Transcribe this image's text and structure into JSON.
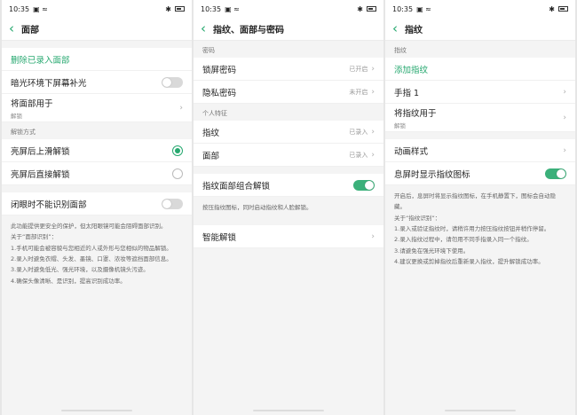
{
  "status": {
    "time": "10:35",
    "icons_left": "▣ ≈",
    "bt": "✱"
  },
  "s1": {
    "title": "面部",
    "delete": "删除已录入面部",
    "dim_light": "暗光环境下屏幕补光",
    "use_face": "将面部用于",
    "use_face_sub": "解锁",
    "unlock_section": "解锁方式",
    "opt1": "亮屏后上滑解锁",
    "opt2": "亮屏后直接解锁",
    "eyes_closed": "闭眼时不能识别面部",
    "note_lines": [
      "此功能提供更安全的保护，但太阳眼镜可能会阻碍面部识别。",
      "",
      "关于“面部识别”：",
      "1.手机可能会被容貌与您相近的人或外形与您相似的物品解锁。",
      "2.录入时避免衣帽、头发、墨镜、口罩、浓妆等遮挡面部信息。",
      "3.录入时避免低光、强光环境，以及摄像机镜头污迹。",
      "4.确保头像清晰、是识别，提高识别成功率。"
    ]
  },
  "s2": {
    "title": "指纹、面部与密码",
    "pwd_section": "密码",
    "lock_pwd": "锁屏密码",
    "lock_pwd_val": "已开启",
    "privacy_pwd": "隐私密码",
    "privacy_pwd_val": "未开启",
    "personal_section": "个人特征",
    "fingerprint": "指纹",
    "fingerprint_val": "已录入",
    "face": "面部",
    "face_val": "已录入",
    "combo": "指纹面部组合解锁",
    "combo_note": "按压指纹图标，同时启动指纹和人脸解锁。",
    "smart": "智能解锁"
  },
  "s3": {
    "title": "指纹",
    "fp_section": "指纹",
    "add": "添加指纹",
    "finger1": "手指 1",
    "use_fp": "将指纹用于",
    "use_fp_sub": "解锁",
    "anim": "动画样式",
    "show_icon": "息屏时显示指纹图标",
    "note_lines": [
      "开启后，息屏时将显示指纹图标，在手机静置下，图标会自动隐藏。",
      "关于“指纹识别”：",
      "1.录入或验证指纹时，请稍许用力按压指纹按钮并稍作停留。",
      "2.录入指纹过程中，请勿用不同手指录入同一个指纹。",
      "3.请避免在强光环境下使用。",
      "4.建议更换或剪掉指纹后重新录入指纹，提升解锁成功率。"
    ]
  },
  "icons": {
    "chevron": "›",
    "back": "‹"
  }
}
